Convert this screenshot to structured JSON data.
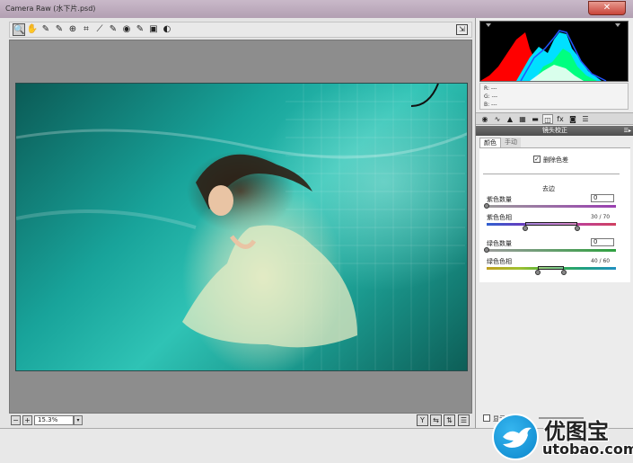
{
  "window": {
    "title": "Camera Raw (水下片.psd)",
    "close_symbol": "✕"
  },
  "toolbar": {
    "tools": [
      {
        "name": "zoom-tool-icon",
        "glyph": "🔍"
      },
      {
        "name": "hand-tool-icon",
        "glyph": "✋"
      },
      {
        "name": "white-balance-tool-icon",
        "glyph": "✎"
      },
      {
        "name": "color-sampler-tool-icon",
        "glyph": "✎"
      },
      {
        "name": "target-adjustment-tool-icon",
        "glyph": "⊕"
      },
      {
        "name": "crop-tool-icon",
        "glyph": "⌗"
      },
      {
        "name": "straighten-tool-icon",
        "glyph": "⟋"
      },
      {
        "name": "spot-removal-tool-icon",
        "glyph": "✎"
      },
      {
        "name": "red-eye-tool-icon",
        "glyph": "◉"
      },
      {
        "name": "adjustment-brush-icon",
        "glyph": "✎"
      },
      {
        "name": "graduated-filter-icon",
        "glyph": "▣"
      },
      {
        "name": "preferences-icon",
        "glyph": "◐"
      }
    ],
    "fullscreen_glyph": "⇲"
  },
  "zoom": {
    "value": "15.3%",
    "minus": "−",
    "plus": "+",
    "dropdown": "▾"
  },
  "view_buttons": [
    "Y",
    "⇆",
    "⇅",
    "☰"
  ],
  "rgb_readout": {
    "r": "R:  ---",
    "g": "G:  ---",
    "b": "B:  ---"
  },
  "panel_tabs": [
    {
      "name": "basic-tab-icon",
      "glyph": "◉"
    },
    {
      "name": "tone-curve-tab-icon",
      "glyph": "∿"
    },
    {
      "name": "detail-tab-icon",
      "glyph": "▲"
    },
    {
      "name": "hsl-tab-icon",
      "glyph": "▦"
    },
    {
      "name": "split-toning-tab-icon",
      "glyph": "▬"
    },
    {
      "name": "lens-corrections-tab-icon",
      "glyph": "◫"
    },
    {
      "name": "effects-tab-icon",
      "glyph": "fx"
    },
    {
      "name": "camera-calibration-tab-icon",
      "glyph": "◙"
    },
    {
      "name": "presets-tab-icon",
      "glyph": "☰"
    }
  ],
  "lens": {
    "section_title": "镜头校正",
    "section_menu": "☰▸",
    "subtab_color": "颜色",
    "subtab_manual": "手动",
    "remove_ca_label": "删除色差",
    "remove_ca_checked": "✓",
    "defringe_title": "去边",
    "purple_amount_label": "紫色数量",
    "purple_amount_value": "0",
    "purple_hue_label": "紫色色相",
    "purple_hue_value": "30 / 70",
    "green_amount_label": "绿色数量",
    "green_amount_value": "0",
    "green_hue_label": "绿色色相",
    "green_hue_value": "40 / 60"
  },
  "footer": {
    "show_mask_label": "显示蒙版"
  },
  "watermark": {
    "cn": "优图宝",
    "en": "utobao.com"
  }
}
